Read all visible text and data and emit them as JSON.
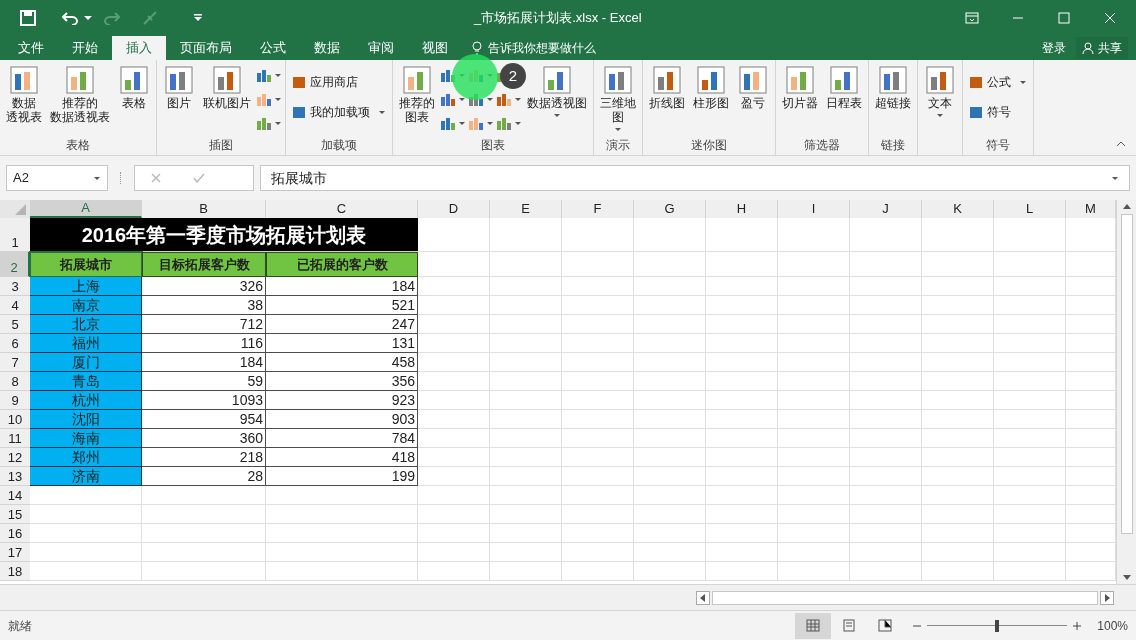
{
  "title_bar": {
    "title": "_市场拓展计划表.xlsx - Excel"
  },
  "menu_tabs": [
    {
      "label": "文件",
      "selected": false
    },
    {
      "label": "开始",
      "selected": false
    },
    {
      "label": "插入",
      "selected": true
    },
    {
      "label": "页面布局",
      "selected": false
    },
    {
      "label": "公式",
      "selected": false
    },
    {
      "label": "数据",
      "selected": false
    },
    {
      "label": "审阅",
      "selected": false
    },
    {
      "label": "视图",
      "selected": false
    }
  ],
  "tell_me": "告诉我你想要做什么",
  "sign_in": "登录",
  "share": "共享",
  "ribbon_groups": [
    {
      "label": "表格",
      "items": [
        {
          "kind": "large",
          "lines": [
            "数据",
            "透视表"
          ],
          "dropdown": false
        },
        {
          "kind": "large",
          "lines": [
            "推荐的",
            "数据透视表"
          ],
          "dropdown": false
        },
        {
          "kind": "large",
          "lines": [
            "表格"
          ],
          "dropdown": false
        }
      ]
    },
    {
      "label": "插图",
      "items": [
        {
          "kind": "large",
          "lines": [
            "图片"
          ],
          "dropdown": false
        },
        {
          "kind": "large",
          "lines": [
            "联机图片"
          ],
          "dropdown": false
        },
        {
          "kind": "icons",
          "dropdown": true
        }
      ]
    },
    {
      "label": "加载项",
      "items": [
        {
          "kind": "small",
          "label": "应用商店",
          "dropdown": false
        },
        {
          "kind": "small",
          "label": "我的加载项",
          "dropdown": true
        }
      ]
    },
    {
      "label": "图表",
      "items": [
        {
          "kind": "large",
          "lines": [
            "推荐的",
            "图表"
          ],
          "dropdown": false
        },
        {
          "kind": "grid",
          "dropdown": true
        },
        {
          "kind": "large",
          "lines": [
            "数据透视图"
          ],
          "dropdown": true
        }
      ]
    },
    {
      "label": "演示",
      "items": [
        {
          "kind": "large",
          "lines": [
            "三维地",
            "图"
          ],
          "dropdown": true
        }
      ]
    },
    {
      "label": "迷你图",
      "items": [
        {
          "kind": "large",
          "lines": [
            "折线图"
          ],
          "dropdown": false
        },
        {
          "kind": "large",
          "lines": [
            "柱形图"
          ],
          "dropdown": false
        },
        {
          "kind": "large",
          "lines": [
            "盈亏"
          ],
          "dropdown": false
        }
      ]
    },
    {
      "label": "筛选器",
      "items": [
        {
          "kind": "large",
          "lines": [
            "切片器"
          ],
          "dropdown": false
        },
        {
          "kind": "large",
          "lines": [
            "日程表"
          ],
          "dropdown": false
        }
      ]
    },
    {
      "label": "链接",
      "items": [
        {
          "kind": "large",
          "lines": [
            "超链接"
          ],
          "dropdown": false
        }
      ]
    },
    {
      "items": [
        {
          "kind": "large",
          "lines": [
            "文本"
          ],
          "dropdown": true
        }
      ]
    },
    {
      "label": "符号",
      "items": [
        {
          "kind": "small",
          "label": "公式",
          "dropdown": true
        },
        {
          "kind": "small",
          "label": "符号",
          "dropdown": false
        }
      ]
    }
  ],
  "step_marker": {
    "number": "2"
  },
  "formula_bar": {
    "name_box": "A2",
    "value": "拓展城市"
  },
  "columns": [
    {
      "label": "A",
      "selected": true
    },
    {
      "label": "B",
      "selected": false
    },
    {
      "label": "C",
      "selected": false
    },
    {
      "label": "D",
      "selected": false
    },
    {
      "label": "E",
      "selected": false
    },
    {
      "label": "F",
      "selected": false
    },
    {
      "label": "G",
      "selected": false
    },
    {
      "label": "H",
      "selected": false
    },
    {
      "label": "I",
      "selected": false
    },
    {
      "label": "J",
      "selected": false
    },
    {
      "label": "K",
      "selected": false
    },
    {
      "label": "L",
      "selected": false
    },
    {
      "label": "M",
      "selected": false
    }
  ],
  "rows": [
    {
      "header": "1",
      "selected": false,
      "kind": "title",
      "cells": [
        "2016年第一季度市场拓展计划表"
      ]
    },
    {
      "header": "2",
      "selected": true,
      "kind": "heading",
      "cells": [
        "拓展城市",
        "目标拓展客户数",
        "已拓展的客户数"
      ]
    },
    {
      "header": "3",
      "selected": false,
      "kind": "data",
      "cells": [
        "上海",
        "326",
        "184"
      ]
    },
    {
      "header": "4",
      "selected": false,
      "kind": "data",
      "cells": [
        "南京",
        "38",
        "521"
      ]
    },
    {
      "header": "5",
      "selected": false,
      "kind": "data",
      "cells": [
        "北京",
        "712",
        "247"
      ]
    },
    {
      "header": "6",
      "selected": false,
      "kind": "data",
      "cells": [
        "福州",
        "116",
        "131"
      ]
    },
    {
      "header": "7",
      "selected": false,
      "kind": "data",
      "cells": [
        "厦门",
        "184",
        "458"
      ]
    },
    {
      "header": "8",
      "selected": false,
      "kind": "data",
      "cells": [
        "青岛",
        "59",
        "356"
      ]
    },
    {
      "header": "9",
      "selected": false,
      "kind": "data",
      "cells": [
        "杭州",
        "1093",
        "923"
      ]
    },
    {
      "header": "10",
      "selected": false,
      "kind": "data",
      "cells": [
        "沈阳",
        "954",
        "903"
      ]
    },
    {
      "header": "11",
      "selected": false,
      "kind": "data",
      "cells": [
        "海南",
        "360",
        "784"
      ]
    },
    {
      "header": "12",
      "selected": false,
      "kind": "data",
      "cells": [
        "郑州",
        "218",
        "418"
      ]
    },
    {
      "header": "13",
      "selected": false,
      "kind": "data",
      "cells": [
        "济南",
        "28",
        "199"
      ]
    },
    {
      "header": "14",
      "selected": false,
      "kind": "empty",
      "cells": []
    },
    {
      "header": "15",
      "selected": false,
      "kind": "empty",
      "cells": []
    },
    {
      "header": "16",
      "selected": false,
      "kind": "empty",
      "cells": []
    },
    {
      "header": "17",
      "selected": false,
      "kind": "empty",
      "cells": []
    },
    {
      "header": "18",
      "selected": false,
      "kind": "empty",
      "cells": []
    }
  ],
  "status_bar": {
    "status": "就绪",
    "views": [
      {
        "selected": true
      },
      {
        "selected": false
      },
      {
        "selected": false
      }
    ],
    "zoom": {
      "level": 0.5,
      "reading": "100%"
    }
  }
}
